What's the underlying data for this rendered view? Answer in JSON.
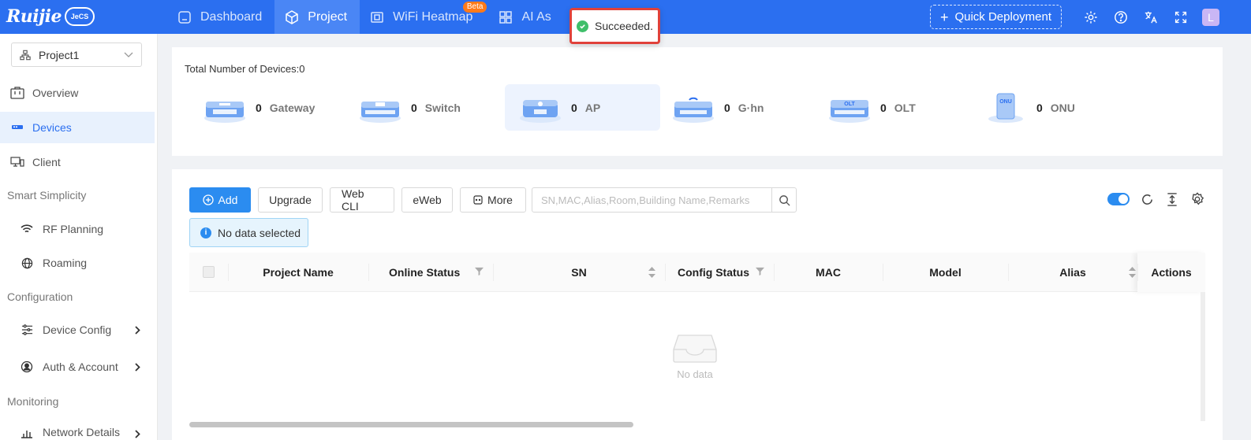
{
  "brand": {
    "logo_text": "Ruijie",
    "logo_badge": "JeCS"
  },
  "nav": {
    "items": [
      {
        "label": "Dashboard",
        "icon": "dashboard-icon"
      },
      {
        "label": "Project",
        "icon": "cube-icon",
        "active": true
      },
      {
        "label": "WiFi Heatmap",
        "icon": "heatmap-icon",
        "badge": "Beta"
      },
      {
        "label": "AI As",
        "icon": "grid-icon"
      }
    ]
  },
  "toast": {
    "message": "Succeeded.",
    "color": "#3fbf6a"
  },
  "header_right": {
    "quick_deployment": "Quick Deployment",
    "avatar_letter": "L"
  },
  "sidebar": {
    "project": "Project1",
    "items": [
      {
        "label": "Overview"
      },
      {
        "label": "Devices",
        "active": true
      },
      {
        "label": "Client"
      },
      {
        "group": "Smart Simplicity"
      },
      {
        "label": "RF Planning"
      },
      {
        "label": "Roaming"
      },
      {
        "group": "Configuration"
      },
      {
        "label": "Device Config"
      },
      {
        "label": "Auth & Account"
      },
      {
        "group": "Monitoring"
      },
      {
        "label": "Network Details"
      }
    ]
  },
  "stats": {
    "total_label": "Total Number of Devices:0",
    "devices": [
      {
        "count": "0",
        "name": "Gateway"
      },
      {
        "count": "0",
        "name": "Switch"
      },
      {
        "count": "0",
        "name": "AP",
        "active": true
      },
      {
        "count": "0",
        "name": "G·hn"
      },
      {
        "count": "0",
        "name": "OLT"
      },
      {
        "count": "0",
        "name": "ONU"
      }
    ]
  },
  "toolbar": {
    "add": "Add",
    "upgrade": "Upgrade",
    "web_cli": "Web CLI",
    "eweb": "eWeb",
    "more": "More",
    "search_placeholder": "SN,MAC,Alias,Room,Building Name,Remarks"
  },
  "selection_alert": "No data selected",
  "table": {
    "columns": [
      "Project Name",
      "Online Status",
      "SN",
      "Config Status",
      "MAC",
      "Model",
      "Alias",
      "Actions"
    ],
    "empty_text": "No data"
  },
  "colors": {
    "primary": "#2b6ff0",
    "accent": "#2b8cf0"
  }
}
